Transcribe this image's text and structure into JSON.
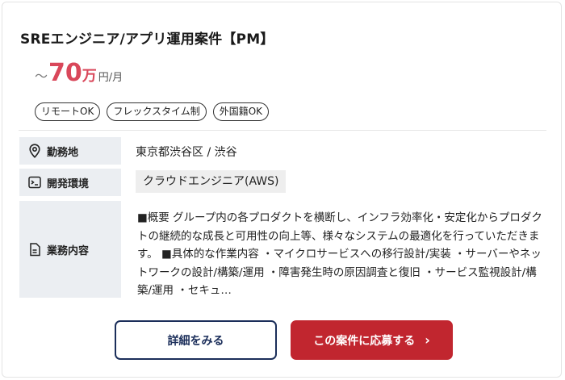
{
  "job": {
    "title": "SREエンジニア/アプリ運用案件【PM】",
    "salary": {
      "prefix": "～",
      "amount": "70",
      "man": "万",
      "unit": "円/月"
    },
    "tags": [
      "リモートOK",
      "フレックスタイム制",
      "外国籍OK"
    ],
    "location": {
      "label": "勤務地",
      "value": "東京都渋谷区 / 渋谷"
    },
    "environment": {
      "label": "開発環境",
      "value": "クラウドエンジニア(AWS)"
    },
    "description": {
      "label": "業務内容",
      "text": "■概要 グループ内の各プロダクトを横断し、インフラ効率化・安定化からプロダクトの継続的な成長と可用性の向上等、様々なシステムの最適化を行っていただきます。 ■具体的な作業内容 ・マイクロサービスへの移行設計/実装 ・サーバーやネットワークの設計/構築/運用 ・障害発生時の原因調査と復旧 ・サービス監視設計/構築/運用 ・セキュ…"
    },
    "buttons": {
      "detail": "詳細をみる",
      "apply": "この案件に応募する",
      "apply_chevron": "›"
    }
  },
  "icons": {
    "location": "map-pin-icon",
    "environment": "terminal-icon",
    "description": "document-icon"
  }
}
